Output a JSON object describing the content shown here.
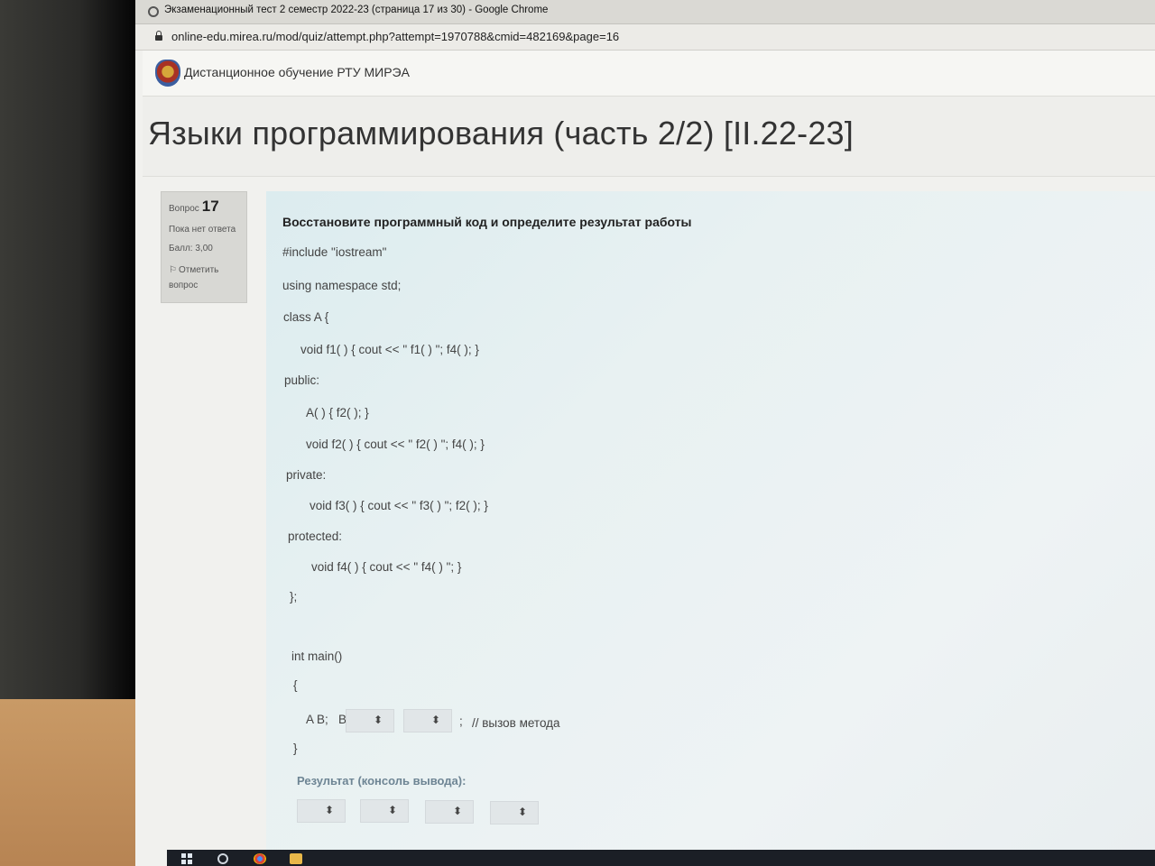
{
  "browser": {
    "window_title": "Экзаменационный тест 2 семестр 2022-23 (страница 17 из 30) - Google Chrome",
    "url": "online-edu.mirea.ru/mod/quiz/attempt.php?attempt=1970788&cmid=482169&page=16"
  },
  "site": {
    "name": "Дистанционное обучение РТУ МИРЭА"
  },
  "course": {
    "title": "Языки программирования (часть 2/2) [II.22-23]"
  },
  "question_info": {
    "label": "Вопрос",
    "number": "17",
    "status": "Пока нет ответа",
    "grade": "Балл: 3,00",
    "flag_label": "Отметить вопрос"
  },
  "question": {
    "prompt": "Восстановите программный код и определите результат работы",
    "code": [
      "#include \"iostream\"",
      "using namespace std;",
      "class A {",
      "void f1( ) { cout << \" f1( ) \"; f4( ); }",
      "public:",
      "A( ) { f2( ); }",
      "void f2( ) { cout << \" f2( ) \"; f4( ); }",
      "private:",
      "void f3( ) { cout << \" f3( ) \"; f2( ); }",
      "protected:",
      "void f4( ) { cout << \" f4( ) \"; }",
      "};",
      "int main()",
      "{",
      "}"
    ],
    "main_line": {
      "prefix": "A B;   B",
      "semicolon": ";",
      "comment": "// вызов метода"
    },
    "result_label": "Результат (консоль вывода):"
  }
}
